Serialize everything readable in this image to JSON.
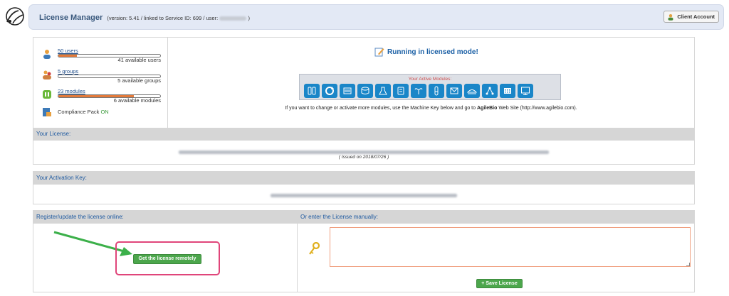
{
  "header": {
    "title": "License Manager",
    "subtitle_prefix": "(version: 5.41 / linked to Service ID: 699 / user:",
    "subtitle_suffix": ")",
    "client_account_label": "Client Account"
  },
  "stats": {
    "users": {
      "label": "50 users",
      "available": "41 available users",
      "used_fraction": 0.18
    },
    "groups": {
      "label": "5 groups",
      "available": "5 available groups",
      "used_fraction": 0.0
    },
    "modules": {
      "label": "23 modules",
      "available": "6 available modules",
      "used_fraction": 0.74
    },
    "compliance_label": "Compliance Pack",
    "compliance_status": "ON"
  },
  "status_message": "Running in licensed mode!",
  "active_modules": {
    "label": "Your Active Modules:",
    "icons": [
      "doors-icon",
      "refresh-icon",
      "equipment-icon",
      "database-icon",
      "flask-icon",
      "document-icon",
      "plant-icon",
      "tube-icon",
      "mail-icon",
      "truck-icon",
      "network-icon",
      "barcode-icon",
      "monitor-icon"
    ]
  },
  "hint": {
    "before": "If you want to change or activate more modules, use the Machine Key below and go to",
    "brand": "AgileBio",
    "after": "Web Site (http://www.agilebio.com)."
  },
  "license": {
    "header": "Your License:",
    "issued": "( Issued on 2018/07/26 )"
  },
  "activation": {
    "header": "Your Activation Key:"
  },
  "register": {
    "header": "Register/update the license online:",
    "button_label": "Get the license remotely"
  },
  "manual": {
    "header": "Or enter the License manually:",
    "save_label": "Save License"
  }
}
